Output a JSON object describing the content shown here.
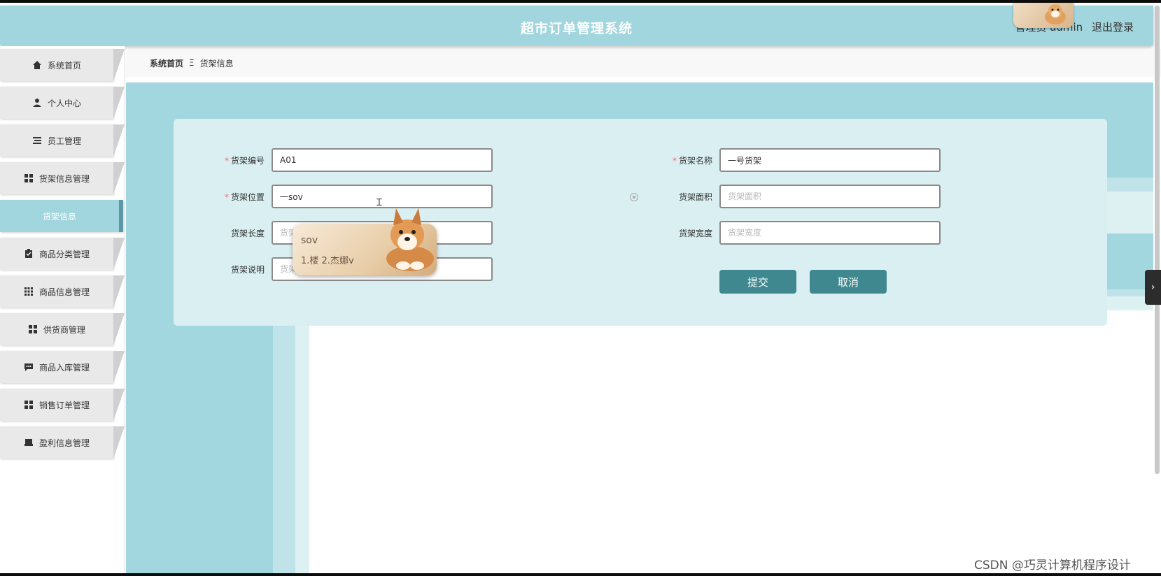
{
  "header": {
    "title": "超市订单管理系统",
    "user": "管理员 admin",
    "logout": "退出登录"
  },
  "sidebar": {
    "items": [
      {
        "label": "系统首页",
        "icon": "home-icon"
      },
      {
        "label": "个人中心",
        "icon": "user-icon"
      },
      {
        "label": "员工管理",
        "icon": "list-icon"
      },
      {
        "label": "货架信息管理",
        "icon": "grid-icon"
      },
      {
        "label": "货架信息",
        "icon": "",
        "active": true
      },
      {
        "label": "商品分类管理",
        "icon": "clipboard-icon"
      },
      {
        "label": "商品信息管理",
        "icon": "apps-icon"
      },
      {
        "label": "供货商管理",
        "icon": "grid-icon"
      },
      {
        "label": "商品入库管理",
        "icon": "chat-icon"
      },
      {
        "label": "销售订单管理",
        "icon": "grid-icon"
      },
      {
        "label": "盈利信息管理",
        "icon": "printer-icon"
      }
    ]
  },
  "breadcrumb": {
    "home": "系统首页",
    "separator": "Ξ",
    "current": "货架信息"
  },
  "form": {
    "code_label": "货架编号",
    "code_value": "A01",
    "name_label": "货架名称",
    "name_value": "一号货架",
    "location_label": "货架位置",
    "location_value": "一sov",
    "area_label": "货架面积",
    "area_placeholder": "货架面积",
    "length_label": "货架长度",
    "length_placeholder": "货架长度",
    "width_label": "货架宽度",
    "width_placeholder": "货架宽度",
    "desc_label": "货架说明",
    "desc_placeholder": "货架说明",
    "submit": "提交",
    "cancel": "取消"
  },
  "ime": {
    "input": "sov",
    "candidates": "1.楼  2.杰娜v"
  },
  "colors": {
    "header_bg": "#a2d6de",
    "button_bg": "#3f8890",
    "required": "#f56c6c"
  },
  "watermark": "CSDN @巧灵计算机程序设计"
}
